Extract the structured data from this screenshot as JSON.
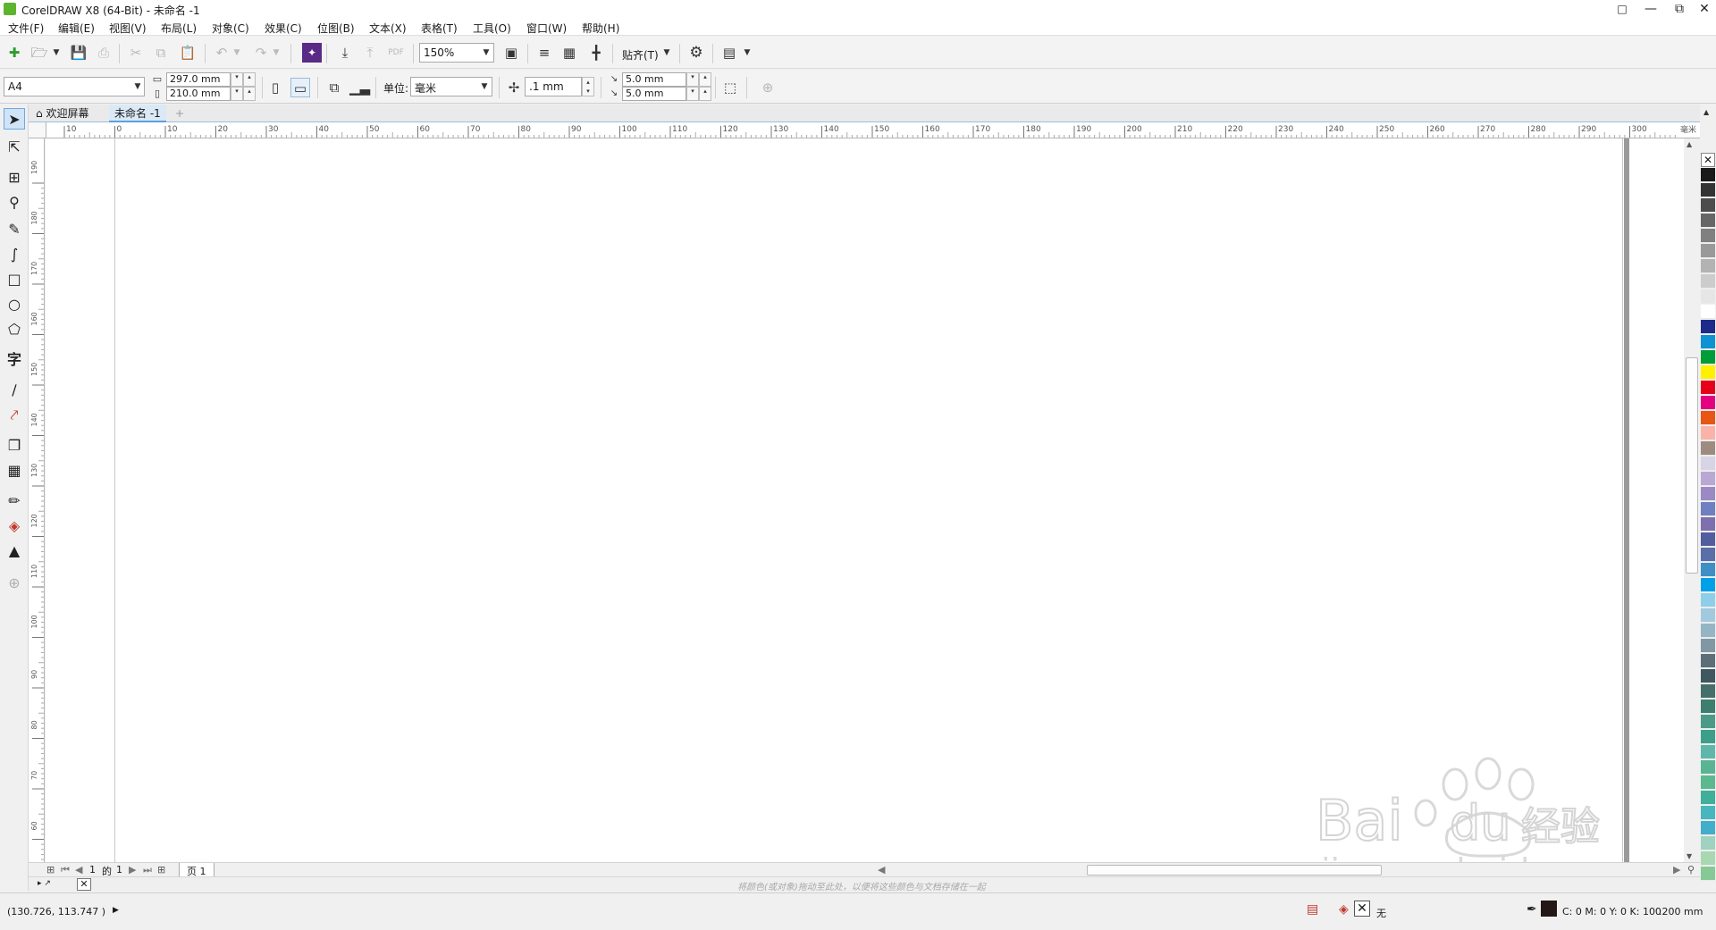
{
  "window": {
    "title": "CorelDRAW X8 (64-Bit) - 未命名 -1",
    "controls": [
      "restore-icon",
      "minimize-icon",
      "maximize-icon",
      "close-icon"
    ]
  },
  "menubar": {
    "items": [
      "文件(F)",
      "编辑(E)",
      "视图(V)",
      "布局(L)",
      "对象(C)",
      "效果(C)",
      "位图(B)",
      "文本(X)",
      "表格(T)",
      "工具(O)",
      "窗口(W)",
      "帮助(H)"
    ]
  },
  "toolbar": {
    "zoom": "150%",
    "snap_label": "贴齐(T)",
    "icons": [
      "new-document-icon",
      "open-icon",
      "save-icon",
      "print-icon",
      "cut-icon",
      "copy-icon",
      "paste-icon",
      "undo-icon",
      "redo-icon",
      "corel-connect-icon",
      "import-icon",
      "export-icon",
      "publish-pdf-icon",
      "full-screen-preview-icon",
      "show-rulers-icon",
      "show-grid-icon",
      "show-guidelines-icon",
      "options-gear-icon",
      "application-launcher-icon"
    ]
  },
  "property_bar": {
    "page_size": "A4",
    "width": "297.0 mm",
    "height": "210.0 mm",
    "units_label": "单位:",
    "units_value": "毫米",
    "nudge": ".1 mm",
    "dup_x": "5.0 mm",
    "dup_y": "5.0 mm"
  },
  "doc_tabs": {
    "welcome": "欢迎屏幕",
    "active": "未命名 -1",
    "add": "+"
  },
  "rulers": {
    "h_labels": [
      "10",
      "0",
      "10",
      "20",
      "30",
      "40",
      "50",
      "60",
      "70",
      "80",
      "90",
      "100",
      "110",
      "120",
      "130",
      "140",
      "150",
      "160",
      "170",
      "180",
      "190",
      "200",
      "210",
      "220",
      "230",
      "240",
      "250",
      "260",
      "270",
      "280",
      "290",
      "300",
      "毫米"
    ],
    "v_labels": [
      "190",
      "180",
      "170",
      "160",
      "150",
      "140",
      "130",
      "120",
      "110",
      "100",
      "90",
      "80",
      "70",
      "60"
    ]
  },
  "page_nav": {
    "current": "1",
    "of_label": "的",
    "total": "1",
    "page_tab": "页 1"
  },
  "color_tray": {
    "hint": "将颜色(或对象)拖动至此处，以便将这些颜色与文档存储在一起"
  },
  "status": {
    "coords": "(130.726, 113.747 )",
    "fill": "无",
    "outline_color": "C: 0 M: 0 Y: 0 K: 100",
    "outline_width": ".200 mm"
  },
  "palette": {
    "colors": [
      "#1a1a1a",
      "#333333",
      "#4d4d4d",
      "#666666",
      "#808080",
      "#999999",
      "#b3b3b3",
      "#cccccc",
      "#e6e6e6",
      "#ffffff",
      "#1e2a8a",
      "#0e92d2",
      "#009c3a",
      "#fff000",
      "#e6001a",
      "#e4007f",
      "#e95513",
      "#f9b3a8",
      "#9e8b80",
      "#d9d3e6",
      "#b9a8d6",
      "#9b89c4",
      "#6f7fbf",
      "#7e6fae",
      "#515d9e",
      "#5a6ea8",
      "#3f8fc6",
      "#00a0e9",
      "#8dcfe9",
      "#a2c9dd",
      "#95b5c4",
      "#7f98a3",
      "#5c6f78",
      "#3f5860",
      "#466f6b",
      "#3c7f6e",
      "#4c9a88",
      "#3d9f8a",
      "#5eb7a9",
      "#59b493",
      "#5bb88f",
      "#3fae9a",
      "#47b7bd",
      "#43aec9",
      "#9fd2bf",
      "#a8d8b2",
      "#86c994"
    ],
    "watermark": "Baidu经验 jingyan.baidu.com"
  }
}
